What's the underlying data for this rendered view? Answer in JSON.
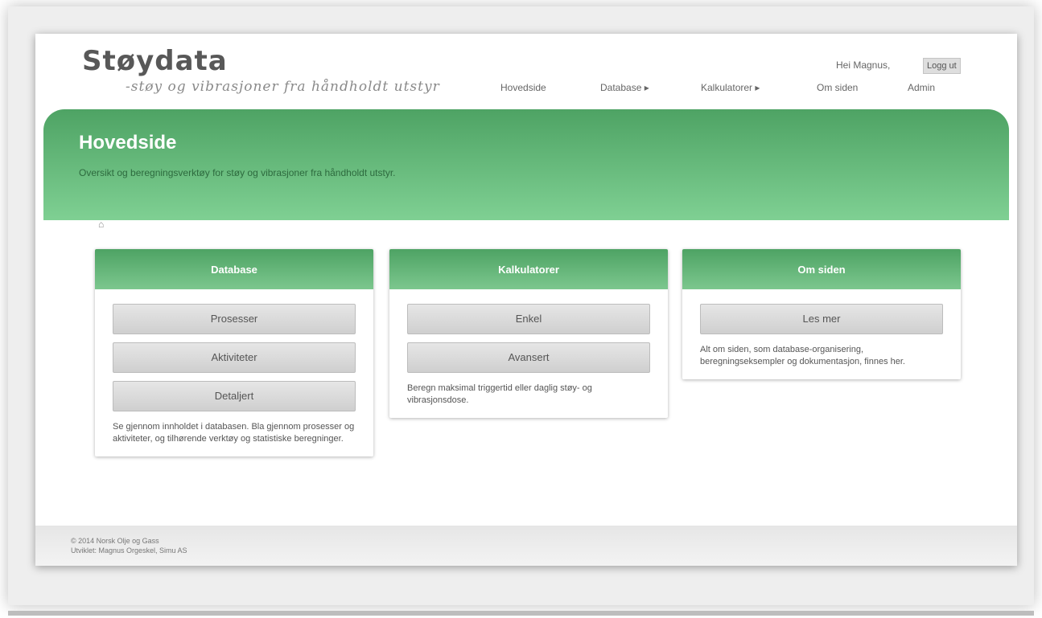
{
  "header": {
    "logo_title": "Støydata",
    "logo_subtitle": "-støy og vibrasjoner fra håndholdt utstyr",
    "greeting": "Hei Magnus,",
    "login_label": "Logg ut"
  },
  "nav": {
    "items": [
      {
        "label": "Hovedside"
      },
      {
        "label": "Database ▸"
      },
      {
        "label": "Kalkulatorer ▸"
      },
      {
        "label": "Om siden"
      },
      {
        "label": "Admin"
      }
    ]
  },
  "banner": {
    "title": "Hovedside",
    "subtitle": "Oversikt og beregningsverktøy for støy og vibrasjoner fra håndholdt utstyr."
  },
  "cards": [
    {
      "title": "Database",
      "buttons": [
        "Prosesser",
        "Aktiviteter",
        "Detaljert"
      ],
      "description": "Se gjennom innholdet i databasen. Bla gjennom prosesser og aktiviteter, og tilhørende verktøy og statistiske beregninger."
    },
    {
      "title": "Kalkulatorer",
      "buttons": [
        "Enkel",
        "Avansert"
      ],
      "description": "Beregn maksimal triggertid eller daglig støy- og vibrasjonsdose."
    },
    {
      "title": "Om siden",
      "buttons": [
        "Les mer"
      ],
      "description": "Alt om siden, som database-organisering, beregningseksempler og dokumentasjon, finnes her."
    }
  ],
  "footer": {
    "line1": "© 2014 Norsk Olje og Gass",
    "line2": "Utviklet: Magnus Orgeskel, Simu AS"
  }
}
